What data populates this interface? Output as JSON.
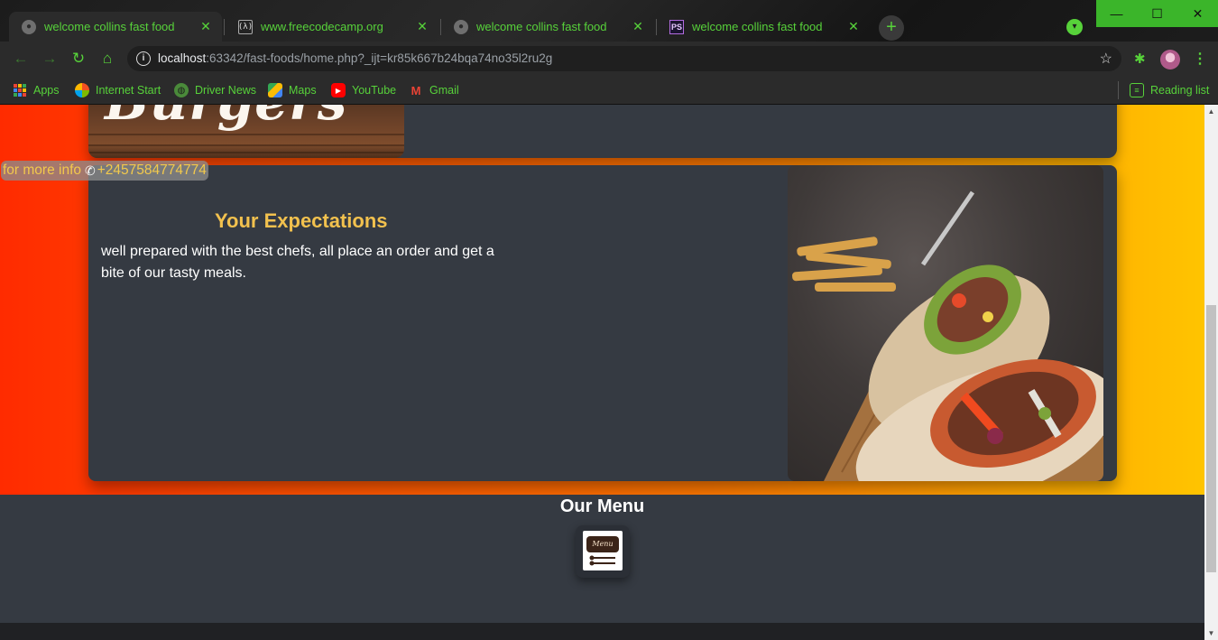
{
  "browser": {
    "tabs": [
      {
        "title": "welcome collins fast food",
        "favicon": "globe-icon"
      },
      {
        "title": "www.freecodecamp.org",
        "favicon": "freecodecamp-icon",
        "favicon_text": "(λ)"
      },
      {
        "title": "welcome collins fast food",
        "favicon": "globe-icon"
      },
      {
        "title": "welcome collins fast food",
        "favicon": "phpstorm-icon",
        "favicon_text": "PS"
      }
    ],
    "active_tab_index": 0,
    "url_host": "localhost",
    "url_rest": ":63342/fast-foods/home.php?_ijt=kr85k667b24bqa74no35l2ru2g",
    "bookmarks": [
      {
        "label": "Apps",
        "icon": "apps-grid-icon"
      },
      {
        "label": "Internet Start",
        "icon": "internet-start-icon"
      },
      {
        "label": "Driver News",
        "icon": "globe-icon"
      },
      {
        "label": "Maps",
        "icon": "maps-icon"
      },
      {
        "label": "YouTube",
        "icon": "youtube-icon"
      },
      {
        "label": "Gmail",
        "icon": "gmail-icon"
      }
    ],
    "reading_list": "Reading list",
    "accent_color": "#57d23a"
  },
  "page": {
    "top_card_image_text": "Burgers",
    "info_chip": {
      "prefix": "for more info",
      "phone_icon": "phone-icon",
      "phone": "+2457584774774"
    },
    "expectations": {
      "heading": "Your Expectations",
      "body": "well prepared with the best chefs, all place an order and get a bite of our tasty meals."
    },
    "menu": {
      "title": "Our Menu",
      "tile_text": "Menu"
    },
    "colors": {
      "heading": "#f2c14e",
      "card_bg": "#353a42",
      "gradient_start": "#ff2b00",
      "gradient_end": "#ffc400"
    }
  }
}
